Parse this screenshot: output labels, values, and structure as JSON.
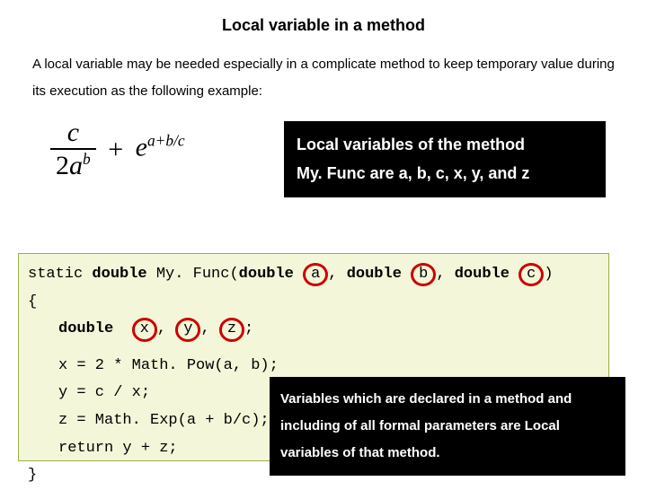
{
  "title": "Local variable in a method",
  "intro": "A local variable may be needed especially in a complicate method to keep temporary value during its execution as the following example:",
  "formula": {
    "numerator": "c",
    "denominator_coeff": "2",
    "denominator_base": "a",
    "denominator_exp": "b",
    "plus": "+",
    "e_base": "e",
    "e_exp": "a+b/c"
  },
  "callout_top_line1": "Local variables of the method",
  "callout_top_line2": "My. Func are a, b, c, x, y, and z",
  "code": {
    "sig_pre": "static ",
    "sig_double1": "double",
    "sig_name": " My. Func(",
    "sig_double2": "double",
    "param_a": "a",
    "sep1": ", ",
    "sig_double3": "double",
    "param_b": "b",
    "sep2": ", ",
    "sig_double4": "double",
    "param_c": "c",
    "sig_close": ")",
    "brace_open": "{",
    "decl_double": "double",
    "decl_x": "x",
    "decl_sep1": ", ",
    "decl_y": "y",
    "decl_sep2": ", ",
    "decl_z": "z",
    "decl_end": ";",
    "l1": "x = 2 * Math. Pow(a, b);",
    "l2": " y = c / x;",
    "l3": "z = Math. Exp(a + b/c);",
    "l4": "return  y + z;",
    "brace_close": "}"
  },
  "callout_bottom": "Variables which are declared in a method and including of all formal parameters are Local variables of that method."
}
